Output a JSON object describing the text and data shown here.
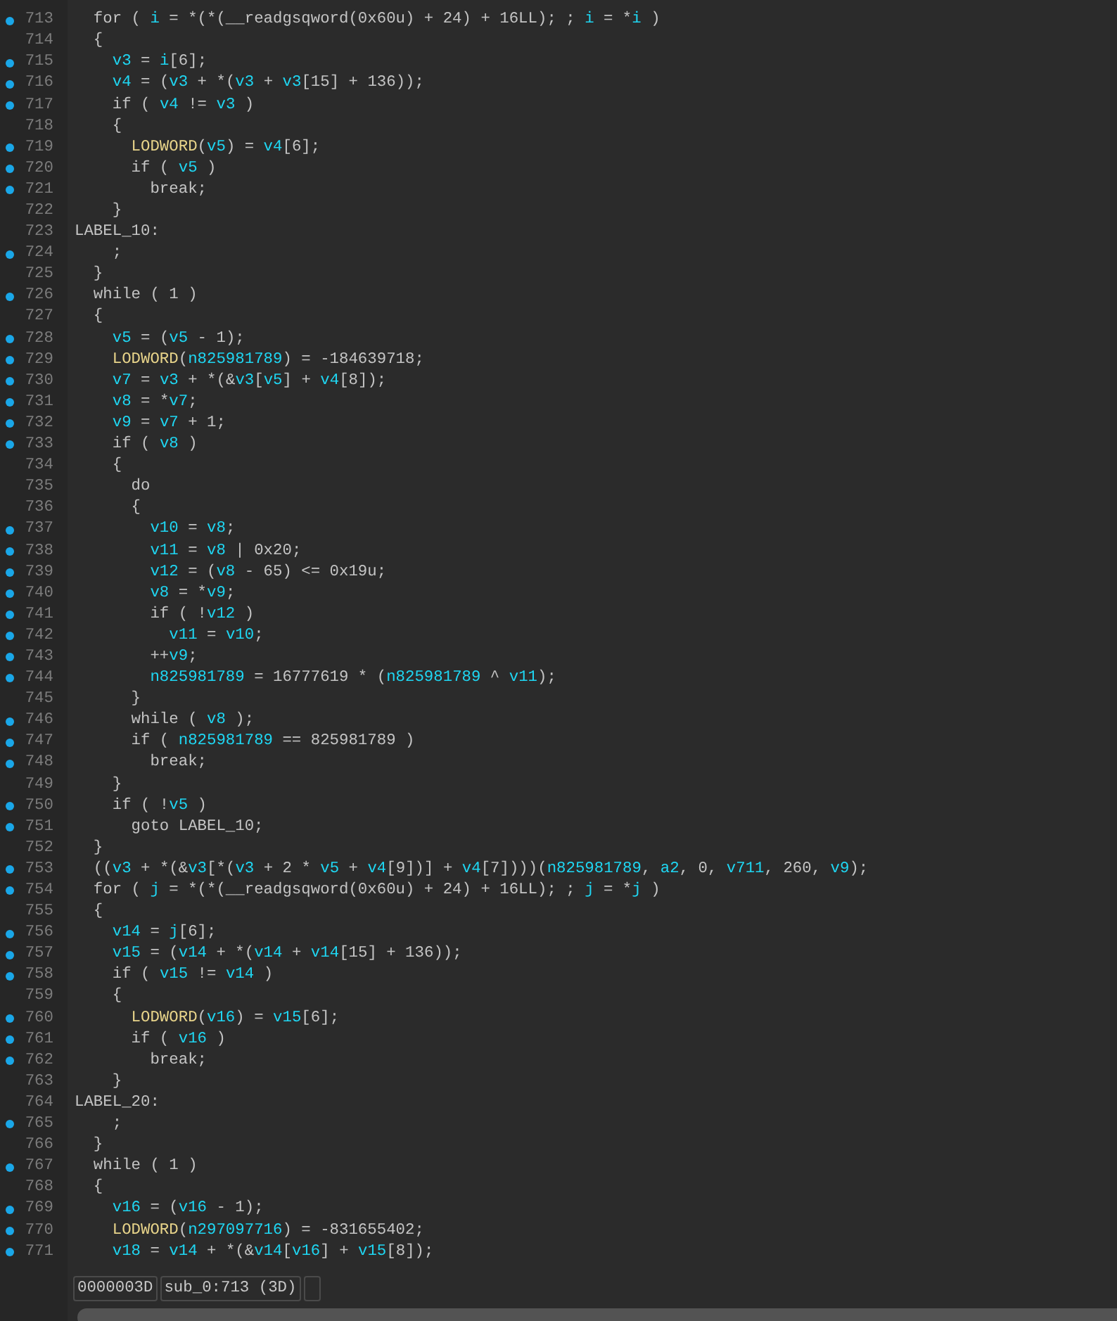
{
  "code_view": {
    "lines": [
      {
        "number": "713",
        "breakpoint": true,
        "segments": [
          {
            "kind": "plain",
            "text": "  for ( "
          },
          {
            "kind": "var",
            "text": "i"
          },
          {
            "kind": "plain",
            "text": " = *(*(__readgsqword(0x60u) + 24) + 16LL); ; "
          },
          {
            "kind": "var",
            "text": "i"
          },
          {
            "kind": "plain",
            "text": " = *"
          },
          {
            "kind": "var",
            "text": "i"
          },
          {
            "kind": "plain",
            "text": " )"
          }
        ]
      },
      {
        "number": "714",
        "breakpoint": false,
        "segments": [
          {
            "kind": "plain",
            "text": "  {"
          }
        ]
      },
      {
        "number": "715",
        "breakpoint": true,
        "segments": [
          {
            "kind": "var",
            "text": "    v3"
          },
          {
            "kind": "plain",
            "text": " = "
          },
          {
            "kind": "var",
            "text": "i"
          },
          {
            "kind": "plain",
            "text": "[6];"
          }
        ]
      },
      {
        "number": "716",
        "breakpoint": true,
        "segments": [
          {
            "kind": "var",
            "text": "    v4"
          },
          {
            "kind": "plain",
            "text": " = ("
          },
          {
            "kind": "var",
            "text": "v3"
          },
          {
            "kind": "plain",
            "text": " + *("
          },
          {
            "kind": "var",
            "text": "v3"
          },
          {
            "kind": "plain",
            "text": " + "
          },
          {
            "kind": "var",
            "text": "v3"
          },
          {
            "kind": "plain",
            "text": "[15] + 136));"
          }
        ]
      },
      {
        "number": "717",
        "breakpoint": true,
        "segments": [
          {
            "kind": "plain",
            "text": "    if ( "
          },
          {
            "kind": "var",
            "text": "v4"
          },
          {
            "kind": "plain",
            "text": " != "
          },
          {
            "kind": "var",
            "text": "v3"
          },
          {
            "kind": "plain",
            "text": " )"
          }
        ]
      },
      {
        "number": "718",
        "breakpoint": false,
        "segments": [
          {
            "kind": "plain",
            "text": "    {"
          }
        ]
      },
      {
        "number": "719",
        "breakpoint": true,
        "segments": [
          {
            "kind": "func",
            "text": "      LODWORD"
          },
          {
            "kind": "plain",
            "text": "("
          },
          {
            "kind": "var",
            "text": "v5"
          },
          {
            "kind": "plain",
            "text": ") = "
          },
          {
            "kind": "var",
            "text": "v4"
          },
          {
            "kind": "plain",
            "text": "[6];"
          }
        ]
      },
      {
        "number": "720",
        "breakpoint": true,
        "segments": [
          {
            "kind": "plain",
            "text": "      if ( "
          },
          {
            "kind": "var",
            "text": "v5"
          },
          {
            "kind": "plain",
            "text": " )"
          }
        ]
      },
      {
        "number": "721",
        "breakpoint": true,
        "segments": [
          {
            "kind": "plain",
            "text": "        break;"
          }
        ]
      },
      {
        "number": "722",
        "breakpoint": false,
        "segments": [
          {
            "kind": "plain",
            "text": "    }"
          }
        ]
      },
      {
        "number": "723",
        "breakpoint": false,
        "segments": [
          {
            "kind": "plain",
            "text": "LABEL_10:"
          }
        ]
      },
      {
        "number": "724",
        "breakpoint": true,
        "segments": [
          {
            "kind": "plain",
            "text": "    ;"
          }
        ]
      },
      {
        "number": "725",
        "breakpoint": false,
        "segments": [
          {
            "kind": "plain",
            "text": "  }"
          }
        ]
      },
      {
        "number": "726",
        "breakpoint": true,
        "segments": [
          {
            "kind": "plain",
            "text": "  while ( 1 )"
          }
        ]
      },
      {
        "number": "727",
        "breakpoint": false,
        "segments": [
          {
            "kind": "plain",
            "text": "  {"
          }
        ]
      },
      {
        "number": "728",
        "breakpoint": true,
        "segments": [
          {
            "kind": "var",
            "text": "    v5"
          },
          {
            "kind": "plain",
            "text": " = ("
          },
          {
            "kind": "var",
            "text": "v5"
          },
          {
            "kind": "plain",
            "text": " - 1);"
          }
        ]
      },
      {
        "number": "729",
        "breakpoint": true,
        "segments": [
          {
            "kind": "func",
            "text": "    LODWORD"
          },
          {
            "kind": "plain",
            "text": "("
          },
          {
            "kind": "var",
            "text": "n825981789"
          },
          {
            "kind": "plain",
            "text": ") = -184639718;"
          }
        ]
      },
      {
        "number": "730",
        "breakpoint": true,
        "segments": [
          {
            "kind": "var",
            "text": "    v7"
          },
          {
            "kind": "plain",
            "text": " = "
          },
          {
            "kind": "var",
            "text": "v3"
          },
          {
            "kind": "plain",
            "text": " + *(&"
          },
          {
            "kind": "var",
            "text": "v3"
          },
          {
            "kind": "plain",
            "text": "["
          },
          {
            "kind": "var",
            "text": "v5"
          },
          {
            "kind": "plain",
            "text": "] + "
          },
          {
            "kind": "var",
            "text": "v4"
          },
          {
            "kind": "plain",
            "text": "[8]);"
          }
        ]
      },
      {
        "number": "731",
        "breakpoint": true,
        "segments": [
          {
            "kind": "var",
            "text": "    v8"
          },
          {
            "kind": "plain",
            "text": " = *"
          },
          {
            "kind": "var",
            "text": "v7"
          },
          {
            "kind": "plain",
            "text": ";"
          }
        ]
      },
      {
        "number": "732",
        "breakpoint": true,
        "segments": [
          {
            "kind": "var",
            "text": "    v9"
          },
          {
            "kind": "plain",
            "text": " = "
          },
          {
            "kind": "var",
            "text": "v7"
          },
          {
            "kind": "plain",
            "text": " + 1;"
          }
        ]
      },
      {
        "number": "733",
        "breakpoint": true,
        "segments": [
          {
            "kind": "plain",
            "text": "    if ( "
          },
          {
            "kind": "var",
            "text": "v8"
          },
          {
            "kind": "plain",
            "text": " )"
          }
        ]
      },
      {
        "number": "734",
        "breakpoint": false,
        "segments": [
          {
            "kind": "plain",
            "text": "    {"
          }
        ]
      },
      {
        "number": "735",
        "breakpoint": false,
        "segments": [
          {
            "kind": "plain",
            "text": "      do"
          }
        ]
      },
      {
        "number": "736",
        "breakpoint": false,
        "segments": [
          {
            "kind": "plain",
            "text": "      {"
          }
        ]
      },
      {
        "number": "737",
        "breakpoint": true,
        "segments": [
          {
            "kind": "var",
            "text": "        v10"
          },
          {
            "kind": "plain",
            "text": " = "
          },
          {
            "kind": "var",
            "text": "v8"
          },
          {
            "kind": "plain",
            "text": ";"
          }
        ]
      },
      {
        "number": "738",
        "breakpoint": true,
        "segments": [
          {
            "kind": "var",
            "text": "        v11"
          },
          {
            "kind": "plain",
            "text": " = "
          },
          {
            "kind": "var",
            "text": "v8"
          },
          {
            "kind": "plain",
            "text": " | 0x20;"
          }
        ]
      },
      {
        "number": "739",
        "breakpoint": true,
        "segments": [
          {
            "kind": "var",
            "text": "        v12"
          },
          {
            "kind": "plain",
            "text": " = ("
          },
          {
            "kind": "var",
            "text": "v8"
          },
          {
            "kind": "plain",
            "text": " - 65) <= 0x19u;"
          }
        ]
      },
      {
        "number": "740",
        "breakpoint": true,
        "segments": [
          {
            "kind": "var",
            "text": "        v8"
          },
          {
            "kind": "plain",
            "text": " = *"
          },
          {
            "kind": "var",
            "text": "v9"
          },
          {
            "kind": "plain",
            "text": ";"
          }
        ]
      },
      {
        "number": "741",
        "breakpoint": true,
        "segments": [
          {
            "kind": "plain",
            "text": "        if ( !"
          },
          {
            "kind": "var",
            "text": "v12"
          },
          {
            "kind": "plain",
            "text": " )"
          }
        ]
      },
      {
        "number": "742",
        "breakpoint": true,
        "segments": [
          {
            "kind": "var",
            "text": "          v11"
          },
          {
            "kind": "plain",
            "text": " = "
          },
          {
            "kind": "var",
            "text": "v10"
          },
          {
            "kind": "plain",
            "text": ";"
          }
        ]
      },
      {
        "number": "743",
        "breakpoint": true,
        "segments": [
          {
            "kind": "plain",
            "text": "        ++"
          },
          {
            "kind": "var",
            "text": "v9"
          },
          {
            "kind": "plain",
            "text": ";"
          }
        ]
      },
      {
        "number": "744",
        "breakpoint": true,
        "segments": [
          {
            "kind": "var",
            "text": "        n825981789"
          },
          {
            "kind": "plain",
            "text": " = 16777619 * ("
          },
          {
            "kind": "var",
            "text": "n825981789"
          },
          {
            "kind": "plain",
            "text": " ^ "
          },
          {
            "kind": "var",
            "text": "v11"
          },
          {
            "kind": "plain",
            "text": ");"
          }
        ]
      },
      {
        "number": "745",
        "breakpoint": false,
        "segments": [
          {
            "kind": "plain",
            "text": "      }"
          }
        ]
      },
      {
        "number": "746",
        "breakpoint": true,
        "segments": [
          {
            "kind": "plain",
            "text": "      while ( "
          },
          {
            "kind": "var",
            "text": "v8"
          },
          {
            "kind": "plain",
            "text": " );"
          }
        ]
      },
      {
        "number": "747",
        "breakpoint": true,
        "segments": [
          {
            "kind": "plain",
            "text": "      if ( "
          },
          {
            "kind": "var",
            "text": "n825981789"
          },
          {
            "kind": "plain",
            "text": " == 825981789 )"
          }
        ]
      },
      {
        "number": "748",
        "breakpoint": true,
        "segments": [
          {
            "kind": "plain",
            "text": "        break;"
          }
        ]
      },
      {
        "number": "749",
        "breakpoint": false,
        "segments": [
          {
            "kind": "plain",
            "text": "    }"
          }
        ]
      },
      {
        "number": "750",
        "breakpoint": true,
        "segments": [
          {
            "kind": "plain",
            "text": "    if ( !"
          },
          {
            "kind": "var",
            "text": "v5"
          },
          {
            "kind": "plain",
            "text": " )"
          }
        ]
      },
      {
        "number": "751",
        "breakpoint": true,
        "segments": [
          {
            "kind": "plain",
            "text": "      goto LABEL_10;"
          }
        ]
      },
      {
        "number": "752",
        "breakpoint": false,
        "segments": [
          {
            "kind": "plain",
            "text": "  }"
          }
        ]
      },
      {
        "number": "753",
        "breakpoint": true,
        "segments": [
          {
            "kind": "plain",
            "text": "  (("
          },
          {
            "kind": "var",
            "text": "v3"
          },
          {
            "kind": "plain",
            "text": " + *(&"
          },
          {
            "kind": "var",
            "text": "v3"
          },
          {
            "kind": "plain",
            "text": "[*("
          },
          {
            "kind": "var",
            "text": "v3"
          },
          {
            "kind": "plain",
            "text": " + 2 * "
          },
          {
            "kind": "var",
            "text": "v5"
          },
          {
            "kind": "plain",
            "text": " + "
          },
          {
            "kind": "var",
            "text": "v4"
          },
          {
            "kind": "plain",
            "text": "[9])] + "
          },
          {
            "kind": "var",
            "text": "v4"
          },
          {
            "kind": "plain",
            "text": "[7])))("
          },
          {
            "kind": "var",
            "text": "n825981789"
          },
          {
            "kind": "plain",
            "text": ", "
          },
          {
            "kind": "var",
            "text": "a2"
          },
          {
            "kind": "plain",
            "text": ", 0, "
          },
          {
            "kind": "var",
            "text": "v711"
          },
          {
            "kind": "plain",
            "text": ", 260, "
          },
          {
            "kind": "var",
            "text": "v9"
          },
          {
            "kind": "plain",
            "text": ");"
          }
        ]
      },
      {
        "number": "754",
        "breakpoint": true,
        "segments": [
          {
            "kind": "plain",
            "text": "  for ( "
          },
          {
            "kind": "var",
            "text": "j"
          },
          {
            "kind": "plain",
            "text": " = *(*(__readgsqword(0x60u) + 24) + 16LL); ; "
          },
          {
            "kind": "var",
            "text": "j"
          },
          {
            "kind": "plain",
            "text": " = *"
          },
          {
            "kind": "var",
            "text": "j"
          },
          {
            "kind": "plain",
            "text": " )"
          }
        ]
      },
      {
        "number": "755",
        "breakpoint": false,
        "segments": [
          {
            "kind": "plain",
            "text": "  {"
          }
        ]
      },
      {
        "number": "756",
        "breakpoint": true,
        "segments": [
          {
            "kind": "var",
            "text": "    v14"
          },
          {
            "kind": "plain",
            "text": " = "
          },
          {
            "kind": "var",
            "text": "j"
          },
          {
            "kind": "plain",
            "text": "[6];"
          }
        ]
      },
      {
        "number": "757",
        "breakpoint": true,
        "segments": [
          {
            "kind": "var",
            "text": "    v15"
          },
          {
            "kind": "plain",
            "text": " = ("
          },
          {
            "kind": "var",
            "text": "v14"
          },
          {
            "kind": "plain",
            "text": " + *("
          },
          {
            "kind": "var",
            "text": "v14"
          },
          {
            "kind": "plain",
            "text": " + "
          },
          {
            "kind": "var",
            "text": "v14"
          },
          {
            "kind": "plain",
            "text": "[15] + 136));"
          }
        ]
      },
      {
        "number": "758",
        "breakpoint": true,
        "segments": [
          {
            "kind": "plain",
            "text": "    if ( "
          },
          {
            "kind": "var",
            "text": "v15"
          },
          {
            "kind": "plain",
            "text": " != "
          },
          {
            "kind": "var",
            "text": "v14"
          },
          {
            "kind": "plain",
            "text": " )"
          }
        ]
      },
      {
        "number": "759",
        "breakpoint": false,
        "segments": [
          {
            "kind": "plain",
            "text": "    {"
          }
        ]
      },
      {
        "number": "760",
        "breakpoint": true,
        "segments": [
          {
            "kind": "func",
            "text": "      LODWORD"
          },
          {
            "kind": "plain",
            "text": "("
          },
          {
            "kind": "var",
            "text": "v16"
          },
          {
            "kind": "plain",
            "text": ") = "
          },
          {
            "kind": "var",
            "text": "v15"
          },
          {
            "kind": "plain",
            "text": "[6];"
          }
        ]
      },
      {
        "number": "761",
        "breakpoint": true,
        "segments": [
          {
            "kind": "plain",
            "text": "      if ( "
          },
          {
            "kind": "var",
            "text": "v16"
          },
          {
            "kind": "plain",
            "text": " )"
          }
        ]
      },
      {
        "number": "762",
        "breakpoint": true,
        "segments": [
          {
            "kind": "plain",
            "text": "        break;"
          }
        ]
      },
      {
        "number": "763",
        "breakpoint": false,
        "segments": [
          {
            "kind": "plain",
            "text": "    }"
          }
        ]
      },
      {
        "number": "764",
        "breakpoint": false,
        "segments": [
          {
            "kind": "plain",
            "text": "LABEL_20:"
          }
        ]
      },
      {
        "number": "765",
        "breakpoint": true,
        "segments": [
          {
            "kind": "plain",
            "text": "    ;"
          }
        ]
      },
      {
        "number": "766",
        "breakpoint": false,
        "segments": [
          {
            "kind": "plain",
            "text": "  }"
          }
        ]
      },
      {
        "number": "767",
        "breakpoint": true,
        "segments": [
          {
            "kind": "plain",
            "text": "  while ( 1 )"
          }
        ]
      },
      {
        "number": "768",
        "breakpoint": false,
        "segments": [
          {
            "kind": "plain",
            "text": "  {"
          }
        ]
      },
      {
        "number": "769",
        "breakpoint": true,
        "segments": [
          {
            "kind": "var",
            "text": "    v16"
          },
          {
            "kind": "plain",
            "text": " = ("
          },
          {
            "kind": "var",
            "text": "v16"
          },
          {
            "kind": "plain",
            "text": " - 1);"
          }
        ]
      },
      {
        "number": "770",
        "breakpoint": true,
        "segments": [
          {
            "kind": "func",
            "text": "    LODWORD"
          },
          {
            "kind": "plain",
            "text": "("
          },
          {
            "kind": "var",
            "text": "n297097716"
          },
          {
            "kind": "plain",
            "text": ") = -831655402;"
          }
        ]
      },
      {
        "number": "771",
        "breakpoint": true,
        "segments": [
          {
            "kind": "var",
            "text": "    v18"
          },
          {
            "kind": "plain",
            "text": " = "
          },
          {
            "kind": "var",
            "text": "v14"
          },
          {
            "kind": "plain",
            "text": " + *(&"
          },
          {
            "kind": "var",
            "text": "v14"
          },
          {
            "kind": "plain",
            "text": "["
          },
          {
            "kind": "var",
            "text": "v16"
          },
          {
            "kind": "plain",
            "text": "] + "
          },
          {
            "kind": "var",
            "text": "v15"
          },
          {
            "kind": "plain",
            "text": "[8]);"
          }
        ]
      }
    ]
  },
  "status_bar": {
    "address": "0000003D",
    "location": "sub_0:713 (3D)"
  }
}
